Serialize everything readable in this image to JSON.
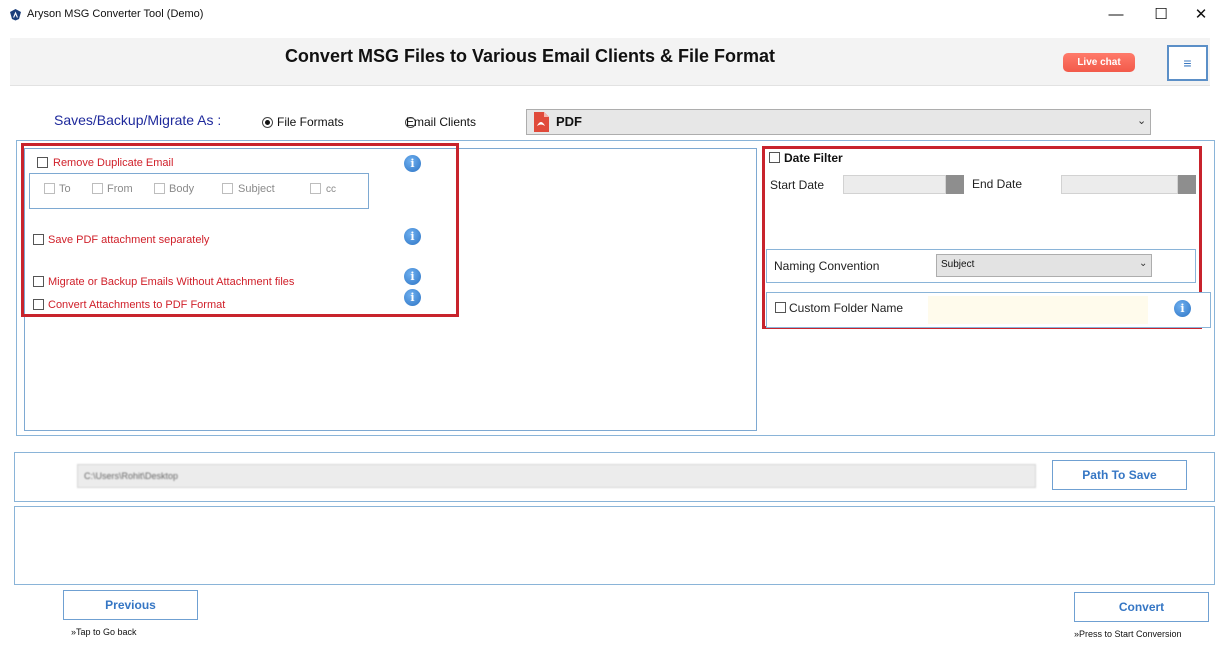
{
  "window": {
    "title": "Aryson MSG Converter Tool (Demo)",
    "minimize_glyph": "—",
    "maximize_glyph": "☐",
    "close_glyph": "✕"
  },
  "header": {
    "title": "Convert MSG Files to Various Email Clients & File Format",
    "live_chat": "Live chat",
    "menu_glyph": "≡"
  },
  "saves": {
    "label": "Saves/Backup/Migrate As :",
    "options": [
      {
        "label": "File Formats",
        "selected": true
      },
      {
        "label": "Email Clients",
        "selected": false
      }
    ],
    "format_value": "PDF",
    "chevron": "⌄"
  },
  "left_options": {
    "remove_duplicate": "Remove Duplicate Email",
    "dup_fields": [
      "To",
      "From",
      "Body",
      "Subject",
      "cc"
    ],
    "save_pdf_attachment": "Save PDF attachment separately",
    "migrate_without_attachment": "Migrate or Backup Emails Without Attachment files",
    "convert_attachments": "Convert Attachments to PDF Format",
    "info_glyph": "i"
  },
  "right_options": {
    "date_filter": "Date Filter",
    "start_date": "Start Date",
    "end_date": "End Date",
    "naming_convention": "Naming Convention",
    "naming_value": "Subject",
    "custom_folder": "Custom Folder Name"
  },
  "path": {
    "value": "C:\\Users\\Rohit\\Desktop",
    "button": "Path To Save"
  },
  "footer": {
    "previous": "Previous",
    "previous_hint": "»Tap to Go back",
    "convert": "Convert",
    "convert_hint": "»Press to Start Conversion"
  },
  "colors": {
    "accent_red": "#c8232c",
    "accent_blue": "#3576c4",
    "live_chat": "#f25a4a"
  }
}
